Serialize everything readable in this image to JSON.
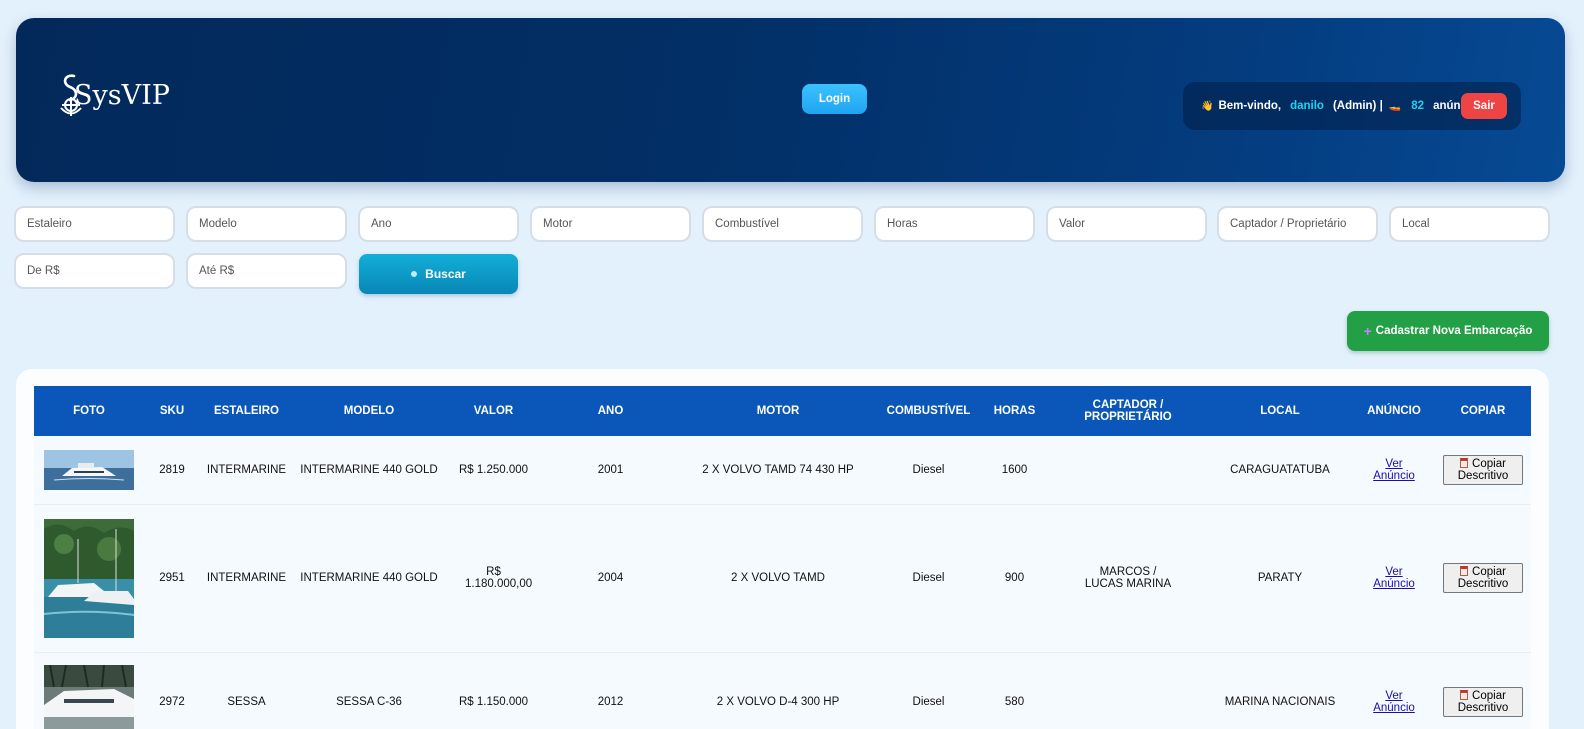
{
  "header": {
    "logo_text": "SysVIP",
    "login_label": "Login",
    "welcome": {
      "wave_icon": "👋",
      "greeting": "Bem-vindo,",
      "username": "danilo",
      "role": "(Admin) |",
      "boat_icon": "🚤",
      "count": "82",
      "count_label": "anúncios",
      "logout_label": "Sair"
    }
  },
  "filters": {
    "estaleiro": "Estaleiro",
    "modelo": "Modelo",
    "ano": "Ano",
    "motor": "Motor",
    "combustivel": "Combustível",
    "horas": "Horas",
    "valor": "Valor",
    "captador": "Captador / Proprietário",
    "local": "Local",
    "de": "De R$",
    "ate": "Até R$",
    "search_label": "Buscar"
  },
  "actions": {
    "new_label": "Cadastrar Nova Embarcação"
  },
  "table": {
    "headers": {
      "foto": "FOTO",
      "sku": "SKU",
      "estaleiro": "ESTALEIRO",
      "modelo": "MODELO",
      "valor": "VALOR",
      "ano": "ANO",
      "motor": "MOTOR",
      "combustivel": "COMBUSTÍVEL",
      "horas": "HORAS",
      "captador": "CAPTADOR / PROPRIETÁRIO",
      "local": "LOCAL",
      "anuncio": "ANÚNCIO",
      "copiar": "COPIAR"
    },
    "link_label": "Ver Anúncio",
    "copy_label": "Copiar Descritivo",
    "rows": [
      {
        "sku": "2819",
        "estaleiro": "INTERMARINE",
        "modelo": "INTERMARINE 440 GOLD",
        "valor": "R$ 1.250.000",
        "ano": "2001",
        "motor": "2 X VOLVO TAMD 74 430 HP",
        "combustivel": "Diesel",
        "horas": "1600",
        "captador": "",
        "local": "CARAGUATATUBA"
      },
      {
        "sku": "2951",
        "estaleiro": "INTERMARINE",
        "modelo": "INTERMARINE 440 GOLD",
        "valor": "R$ 1.180.000,00",
        "ano": "2004",
        "motor": "2 X VOLVO TAMD",
        "combustivel": "Diesel",
        "horas": "900",
        "captador": "MARCOS / LUCAS MARINA",
        "local": "PARATY"
      },
      {
        "sku": "2972",
        "estaleiro": "SESSA",
        "modelo": "SESSA C-36",
        "valor": "R$ 1.150.000",
        "ano": "2012",
        "motor": "2 X VOLVO D-4 300 HP",
        "combustivel": "Diesel",
        "horas": "580",
        "captador": "",
        "local": "MARINA NACIONAIS"
      }
    ]
  }
}
